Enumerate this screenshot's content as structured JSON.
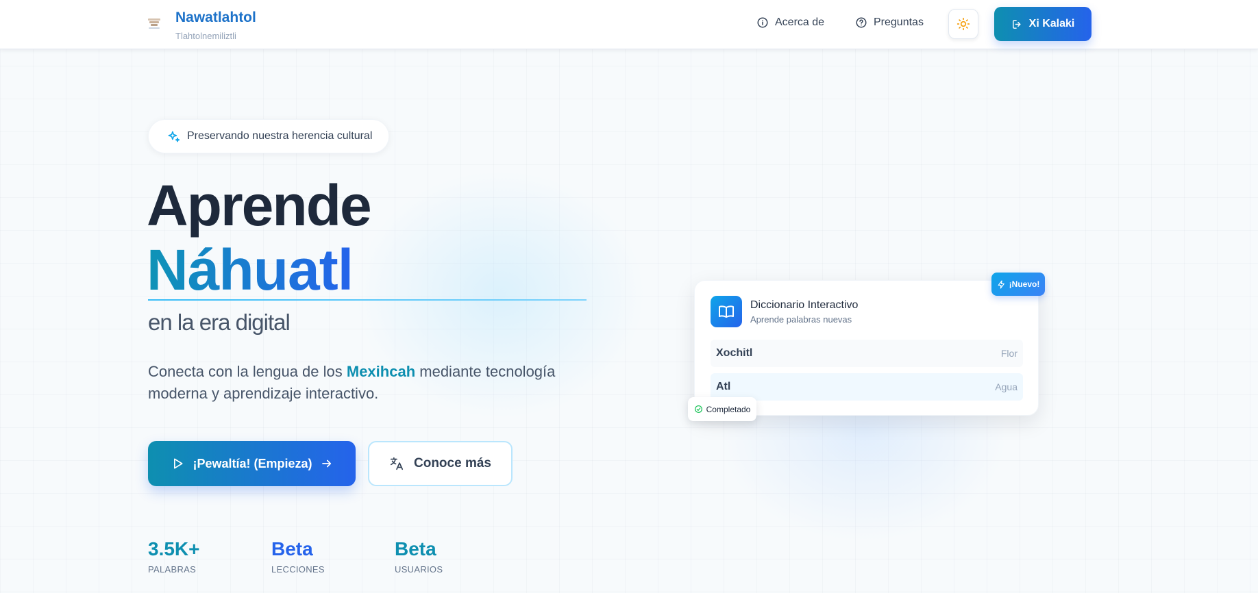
{
  "header": {
    "brand": "Nawatlahtol",
    "subtitle": "Tlahtolnemiliztli",
    "nav": [
      {
        "label": "Acerca de",
        "icon": "info-icon"
      },
      {
        "label": "Preguntas",
        "icon": "help-circle-icon"
      }
    ],
    "theme_toggle_icon": "sun-icon",
    "login_label": "Xi Kalaki",
    "login_icon": "login-icon"
  },
  "hero": {
    "badge": "Preservando nuestra herencia cultural",
    "title_line1": "Aprende",
    "title_line2": "Náhuatl",
    "title_line3": "en la era digital",
    "description_prefix": "Conecta con la lengua de los ",
    "description_highlight": "Mexihcah",
    "description_suffix": " mediante tecnología moderna y aprendizaje interactivo.",
    "primary_cta": "¡Pewaltía! (Empieza)",
    "secondary_cta": "Conoce más"
  },
  "stats": [
    {
      "value": "3.5K+",
      "label": "PALABRAS",
      "color": "#0e8fb0"
    },
    {
      "value": "Beta",
      "label": "LECCIONES",
      "color": "#2563eb"
    },
    {
      "value": "Beta",
      "label": "USUARIOS",
      "color": "#0e8fb0"
    }
  ],
  "card": {
    "badge_new": "¡Nuevo!",
    "title": "Diccionario Interactivo",
    "subtitle": "Aprende palabras nuevas",
    "words": [
      {
        "word": "Xochitl",
        "meaning": "Flor"
      },
      {
        "word": "Atl",
        "meaning": "Agua"
      }
    ],
    "completed": "Completado"
  },
  "colors": {
    "accent": "#0e8fb0",
    "accent2": "#2563eb",
    "text": "#1e293b"
  }
}
